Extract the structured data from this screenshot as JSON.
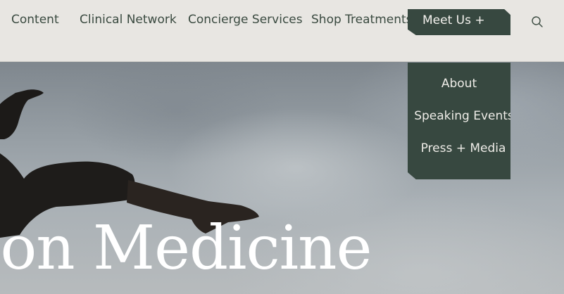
{
  "nav": {
    "items": [
      {
        "label": "Content"
      },
      {
        "label": "Clinical Network"
      },
      {
        "label": "Concierge Services"
      },
      {
        "label": "Shop Treatments"
      }
    ],
    "meet_us_label": "Meet Us +",
    "search_icon": "search-icon"
  },
  "dropdown": {
    "items": [
      {
        "label": "About"
      },
      {
        "label": "Speaking Events"
      },
      {
        "label": "Press + Media"
      }
    ]
  },
  "hero": {
    "title": "ion Medicine"
  },
  "colors": {
    "header_bg": "#e8e6e2",
    "accent_dark_green": "#374840",
    "nav_text": "#3a4a40",
    "hero_title": "#ffffff"
  }
}
